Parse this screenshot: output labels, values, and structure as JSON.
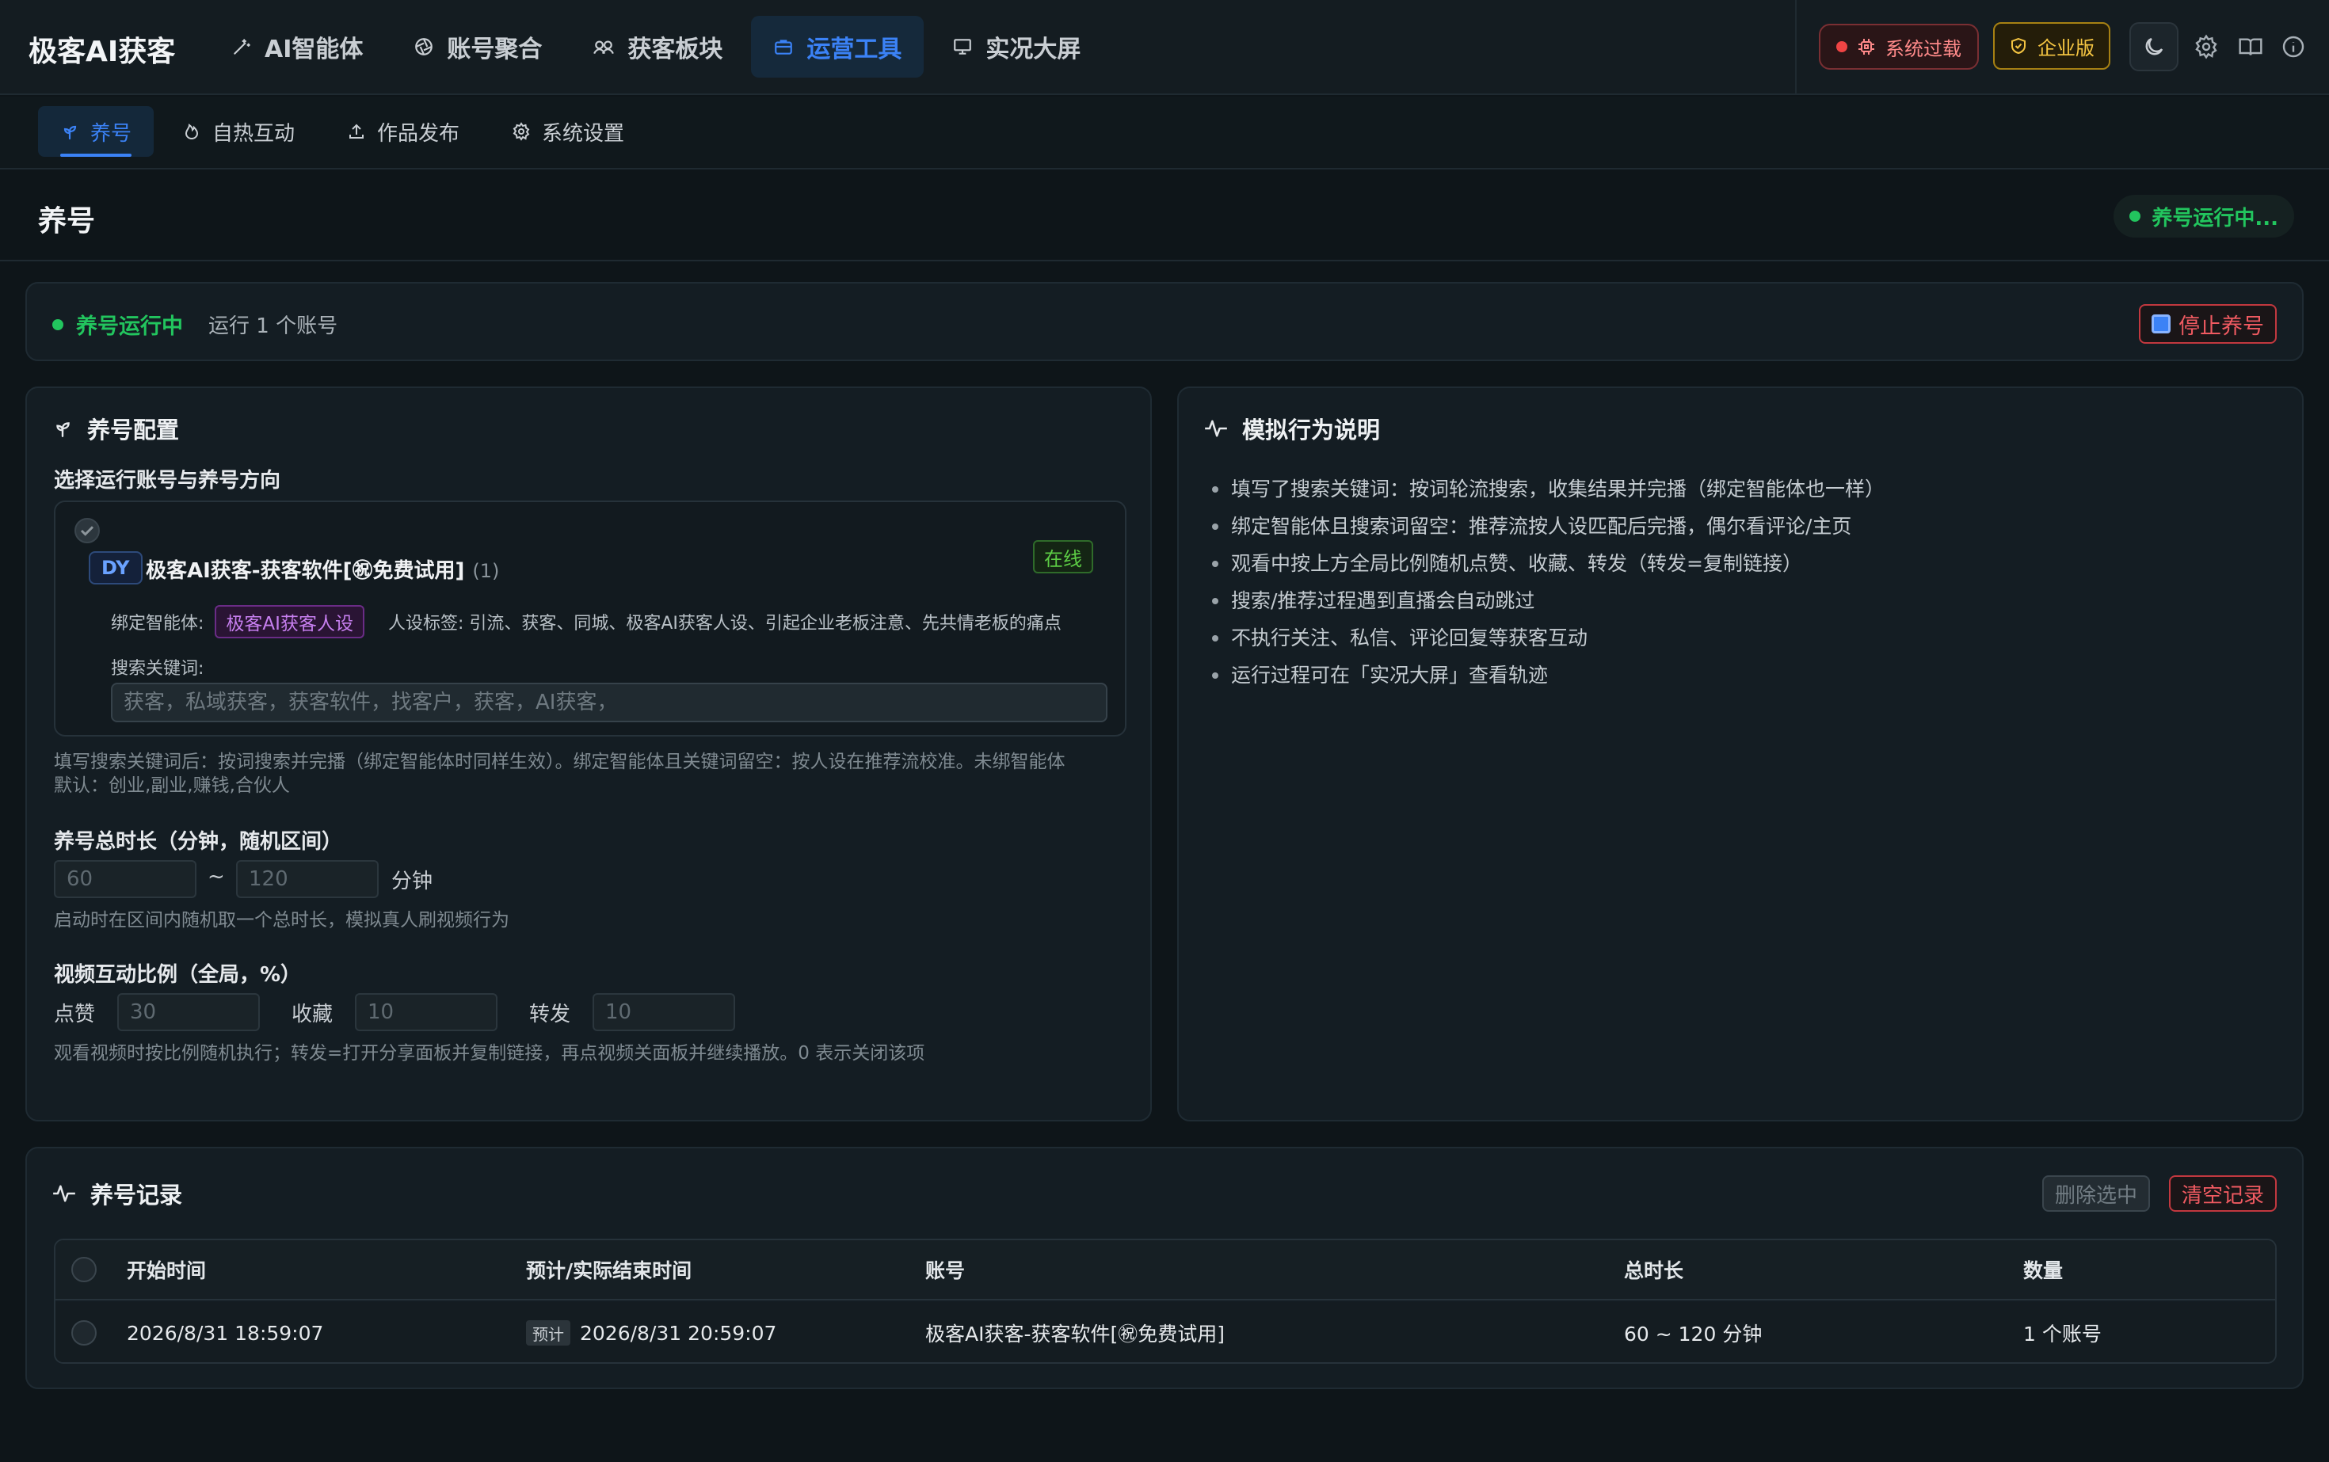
{
  "app": {
    "brand": "极客AI获客"
  },
  "nav": {
    "items": [
      {
        "label": "AI智能体",
        "icon": "wand-icon"
      },
      {
        "label": "账号聚合",
        "icon": "aperture-icon"
      },
      {
        "label": "获客板块",
        "icon": "users-icon"
      },
      {
        "label": "运营工具",
        "icon": "briefcase-icon",
        "active": true
      },
      {
        "label": "实况大屏",
        "icon": "monitor-icon"
      }
    ]
  },
  "topbar": {
    "overload_label": "系统过载",
    "enterprise_label": "企业版",
    "icons": [
      "moon-icon",
      "gear-icon",
      "book-icon",
      "info-icon"
    ]
  },
  "subtabs": [
    {
      "label": "养号",
      "icon": "sprout-icon",
      "active": true
    },
    {
      "label": "自热互动",
      "icon": "flame-icon"
    },
    {
      "label": "作品发布",
      "icon": "upload-icon"
    },
    {
      "label": "系统设置",
      "icon": "gear-icon"
    }
  ],
  "page": {
    "title": "养号",
    "running_pill": "养号运行中..."
  },
  "status": {
    "label": "养号运行中",
    "sub": "运行 1 个账号",
    "stop_label": "停止养号"
  },
  "config": {
    "title": "养号配置",
    "select_label": "选择运行账号与养号方向",
    "account": {
      "platform": "DY",
      "name": "极客AI获客-获客软件[㊗免费试用]",
      "count": "(1)",
      "status": "在线",
      "bind_label": "绑定智能体:",
      "persona": "极客AI获客人设",
      "tags": "人设标签: 引流、获客、同城、极客AI获客人设、引起企业老板注意、先共情老板的痛点",
      "keyword_label": "搜索关键词:",
      "keyword_placeholder": "获客，私域获客，获客软件，找客户，获客，AI获客，"
    },
    "keyword_hint_1": "填写搜索关键词后：按词搜索并完播（绑定智能体时同样生效）。绑定智能体且关键词留空：按人设在推荐流校准。未绑智能体",
    "keyword_hint_2": "默认：创业,副业,赚钱,合伙人",
    "duration_label": "养号总时长（分钟，随机区间）",
    "duration_min": "60",
    "duration_sep": "~",
    "duration_max": "120",
    "duration_unit": "分钟",
    "duration_hint": "启动时在区间内随机取一个总时长，模拟真人刷视频行为",
    "ratio_label": "视频互动比例（全局，%）",
    "like_label": "点赞",
    "like_value": "30",
    "fav_label": "收藏",
    "fav_value": "10",
    "share_label": "转发",
    "share_value": "10",
    "ratio_hint": "观看视频时按比例随机执行；转发=打开分享面板并复制链接，再点视频关面板并继续播放。0 表示关闭该项"
  },
  "description": {
    "title": "模拟行为说明",
    "items": [
      "填写了搜索关键词：按词轮流搜索，收集结果并完播（绑定智能体也一样）",
      "绑定智能体且搜索词留空：推荐流按人设匹配后完播，偶尔看评论/主页",
      "观看中按上方全局比例随机点赞、收藏、转发（转发=复制链接）",
      "搜索/推荐过程遇到直播会自动跳过",
      "不执行关注、私信、评论回复等获客互动",
      "运行过程可在「实况大屏」查看轨迹"
    ]
  },
  "records": {
    "title": "养号记录",
    "delete_selected": "删除选中",
    "clear": "清空记录",
    "columns": [
      "开始时间",
      "预计/实际结束时间",
      "账号",
      "总时长",
      "数量"
    ],
    "rows": [
      {
        "start": "2026/8/31 18:59:07",
        "end_tag": "预计",
        "end": "2026/8/31 20:59:07",
        "account": "极客AI获客-获客软件[㊗免费试用]",
        "duration": "60 ~ 120 分钟",
        "count": "1 个账号"
      }
    ]
  },
  "colors": {
    "accent": "#3b82f6",
    "success": "#22c55e",
    "danger": "#f05a61",
    "warning": "#f5c542",
    "background": "#0e1519"
  }
}
